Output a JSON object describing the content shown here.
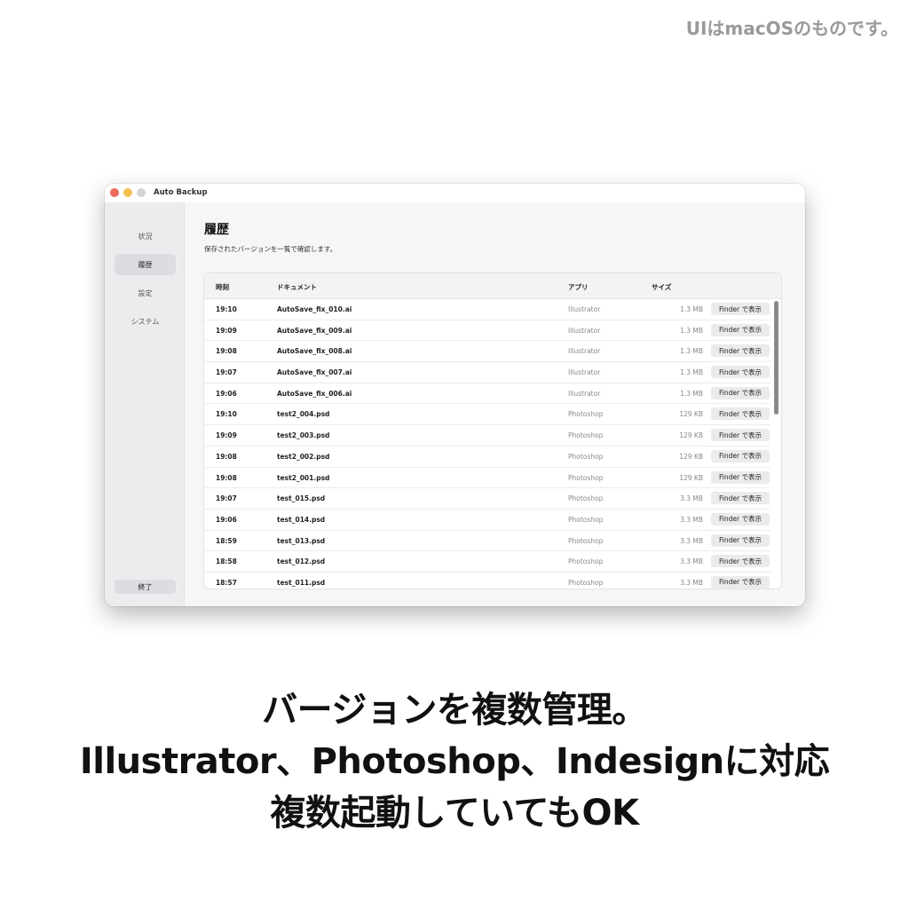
{
  "note": "UIはmacOSのものです。",
  "window": {
    "title": "Auto Backup"
  },
  "sidebar": {
    "items": [
      {
        "label": "状況"
      },
      {
        "label": "履歴"
      },
      {
        "label": "設定"
      },
      {
        "label": "システム"
      }
    ],
    "active_index": 1,
    "quit_label": "終了"
  },
  "main": {
    "title": "履歴",
    "subtitle": "保存されたバージョンを一覧で確認します。"
  },
  "table": {
    "headers": {
      "time": "時刻",
      "document": "ドキュメント",
      "app": "アプリ",
      "size": "サイズ"
    },
    "button_label": "Finder で表示",
    "rows": [
      {
        "time": "19:10",
        "document": "AutoSave_fix_010.ai",
        "app": "Illustrator",
        "size": "1.3 MB"
      },
      {
        "time": "19:09",
        "document": "AutoSave_fix_009.ai",
        "app": "Illustrator",
        "size": "1.3 MB"
      },
      {
        "time": "19:08",
        "document": "AutoSave_fix_008.ai",
        "app": "Illustrator",
        "size": "1.3 MB"
      },
      {
        "time": "19:07",
        "document": "AutoSave_fix_007.ai",
        "app": "Illustrator",
        "size": "1.3 MB"
      },
      {
        "time": "19:06",
        "document": "AutoSave_fix_006.ai",
        "app": "Illustrator",
        "size": "1.3 MB"
      },
      {
        "time": "19:10",
        "document": "test2_004.psd",
        "app": "Photoshop",
        "size": "129 KB"
      },
      {
        "time": "19:09",
        "document": "test2_003.psd",
        "app": "Photoshop",
        "size": "129 KB"
      },
      {
        "time": "19:08",
        "document": "test2_002.psd",
        "app": "Photoshop",
        "size": "129 KB"
      },
      {
        "time": "19:08",
        "document": "test2_001.psd",
        "app": "Photoshop",
        "size": "129 KB"
      },
      {
        "time": "19:07",
        "document": "test_015.psd",
        "app": "Photoshop",
        "size": "3.3 MB"
      },
      {
        "time": "19:06",
        "document": "test_014.psd",
        "app": "Photoshop",
        "size": "3.3 MB"
      },
      {
        "time": "18:59",
        "document": "test_013.psd",
        "app": "Photoshop",
        "size": "3.3 MB"
      },
      {
        "time": "18:58",
        "document": "test_012.psd",
        "app": "Photoshop",
        "size": "3.3 MB"
      },
      {
        "time": "18:57",
        "document": "test_011.psd",
        "app": "Photoshop",
        "size": "3.3 MB"
      }
    ]
  },
  "headline": {
    "line1": "バージョンを複数管理。",
    "line2": "Illustrator、Photoshop、Indesignに対応",
    "line3": "複数起動していてもOK"
  },
  "colors": {
    "traffic_red": "#ec6a5e",
    "traffic_yellow": "#f4bf4f",
    "traffic_gray": "#d5d5d5",
    "sidebar_bg": "#ececef",
    "note_text": "#9a9a9a"
  }
}
